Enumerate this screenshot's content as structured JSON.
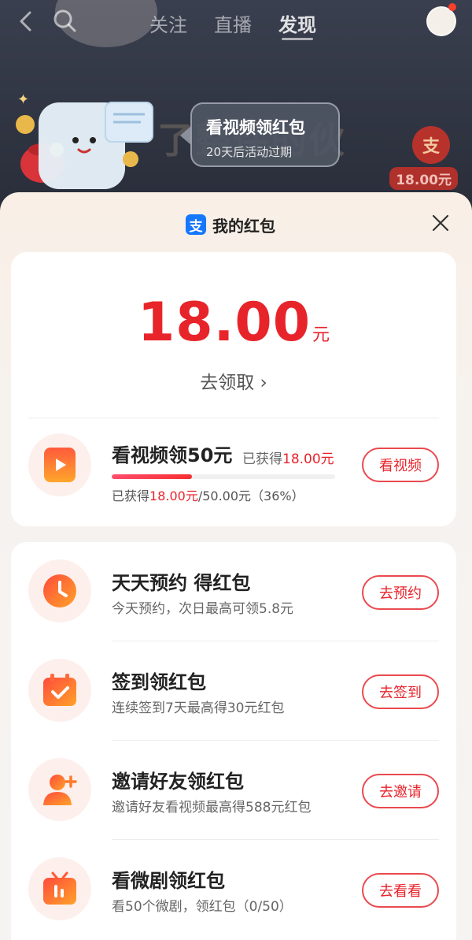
{
  "nav": {
    "tabs": [
      "关注",
      "直播",
      "发现"
    ],
    "active_tab": "发现"
  },
  "background": {
    "price_tag": "18.00元",
    "blur_text": "了整件的伙",
    "zhi_badge": "支"
  },
  "tooltip": {
    "title": "看视频领红包",
    "subtitle": "20天后活动过期"
  },
  "sheet": {
    "title": "我的红包",
    "logo_char": "支"
  },
  "balance": {
    "amount": "18.00",
    "unit": "元",
    "claim_label": "去领取 ›"
  },
  "video_task": {
    "title": "看视频领50元",
    "earned_prefix": "已获得",
    "earned_value": "18.00元",
    "progress_prefix": "已获得",
    "progress_earned": "18.00元",
    "progress_rest": "/50.00元（36%）",
    "progress_percent": 36,
    "button": "看视频"
  },
  "tasks": [
    {
      "title": "天天预约 得红包",
      "subtitle": "今天预约，次日最高可领5.8元",
      "button": "去预约",
      "icon": "clock-icon"
    },
    {
      "title": "签到领红包",
      "subtitle": "连续签到7天最高得30元红包",
      "button": "去签到",
      "icon": "calendar-check-icon"
    },
    {
      "title": "邀请好友领红包",
      "subtitle": "邀请好友看视频最高得588元红包",
      "button": "去邀请",
      "icon": "add-friend-icon"
    },
    {
      "title": "看微剧领红包",
      "subtitle": "看50个微剧，领红包（0/50）",
      "button": "去看看",
      "icon": "tv-icon"
    }
  ],
  "colors": {
    "accent_red": "#e8242b",
    "icon_orange": "#f7652a",
    "alipay_blue": "#1677ff"
  }
}
